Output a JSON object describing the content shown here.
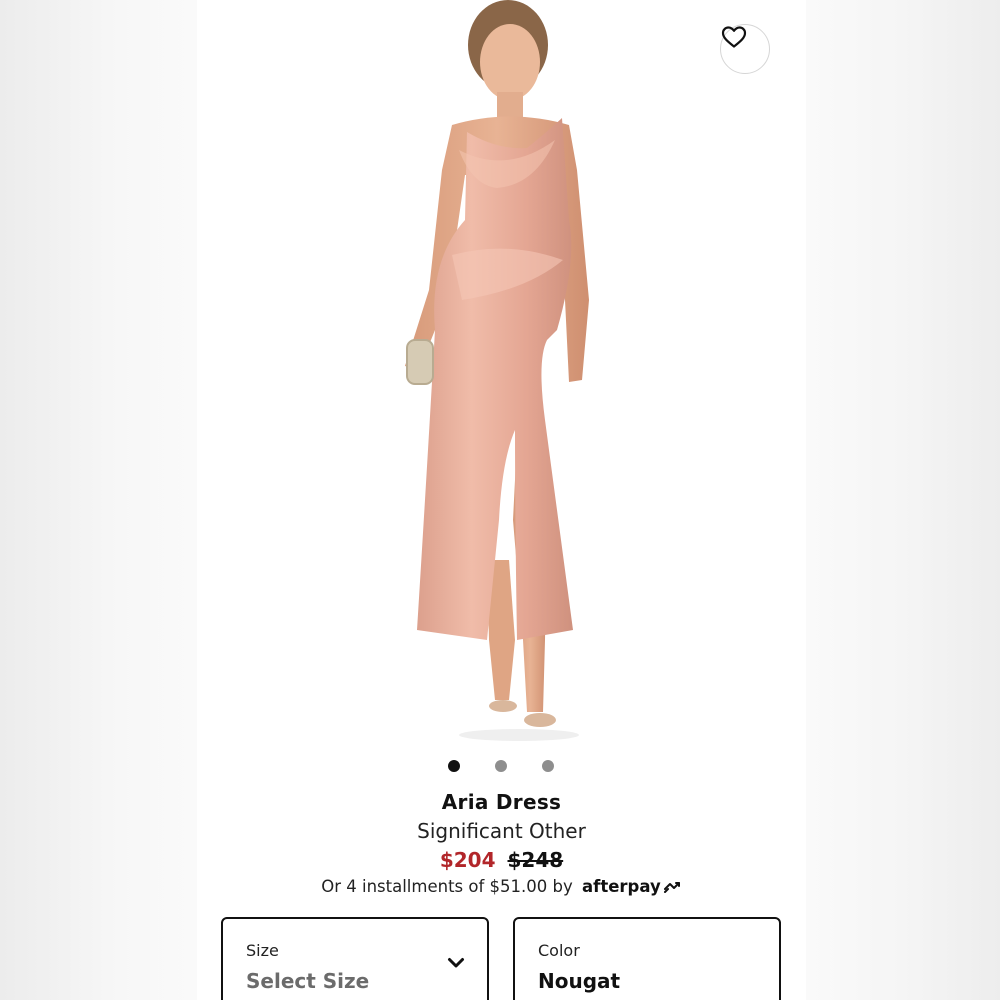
{
  "product": {
    "name": "Aria Dress",
    "brand": "Significant Other",
    "price_sale": "$204",
    "price_original": "$248",
    "installments_text": "Or 4 installments of $51.00 by",
    "afterpay_label": "afterpay"
  },
  "gallery": {
    "total_images": 3,
    "active_index": 0
  },
  "size_selector": {
    "label": "Size",
    "value": "Select Size"
  },
  "color_selector": {
    "label": "Color",
    "value": "Nougat"
  },
  "colors": {
    "sale_price": "#b2262a",
    "dress": "#e8ad9a",
    "dots_inactive": "#8e8e8e",
    "dots_active": "#111111"
  },
  "icons": {
    "wishlist": "heart-outline-icon",
    "dropdown": "chevron-down-icon",
    "afterpay": "afterpay-arrows-icon"
  }
}
